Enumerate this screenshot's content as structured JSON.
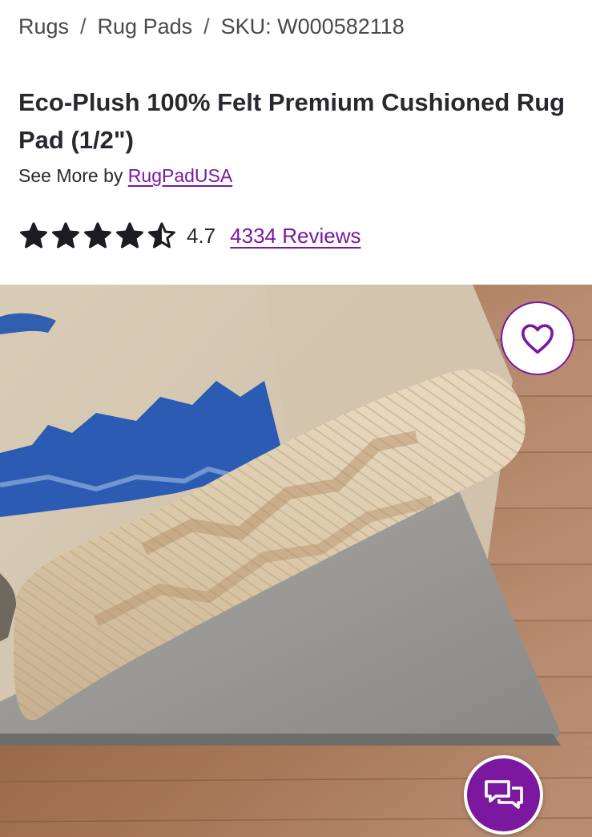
{
  "breadcrumb": {
    "items": [
      {
        "label": "Rugs"
      },
      {
        "label": "Rug Pads"
      },
      {
        "label": "SKU: W000582118"
      }
    ],
    "separator": "/"
  },
  "product": {
    "title": "Eco-Plush 100% Felt Premium Cushioned Rug Pad (1/2\")",
    "see_more_prefix": "See More by",
    "brand": "RugPadUSA",
    "rating_value": "4.7",
    "rating_score": 4.7,
    "rating_max": 5,
    "reviews_label": "4334 Reviews"
  },
  "colors": {
    "accent": "#7b189f",
    "text": "#2b2730"
  },
  "icons": {
    "favorite": "heart-icon",
    "chat": "chat-bubbles-icon",
    "star": "star-icon"
  }
}
